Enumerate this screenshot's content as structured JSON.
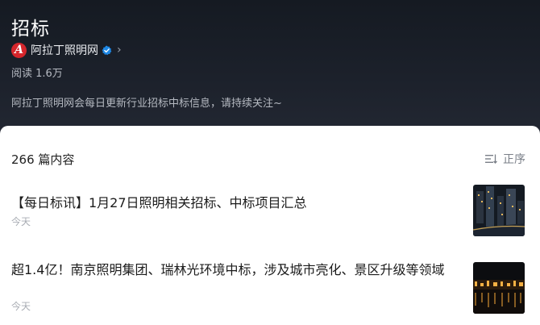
{
  "header": {
    "title": "招标",
    "author": {
      "name": "阿拉丁照明网",
      "logo_letter": "A"
    },
    "reads": "阅读 1.6万",
    "description": "阿拉丁照明网会每日更新行业招标中标信息，请持续关注~"
  },
  "list": {
    "count": "266 篇内容",
    "sort_label": "正序",
    "items": [
      {
        "title": "【每日标讯】1月27日照明相关招标、中标项目汇总",
        "time": "今天",
        "thumbnail": "city-night-aerial"
      },
      {
        "title": "超1.4亿！南京照明集团、瑞林光环境中标，涉及城市亮化、景区升级等领域",
        "time": "今天",
        "thumbnail": "waterfront-night-lights"
      }
    ]
  },
  "colors": {
    "accent": "#d5262c",
    "verified": "#1e88e5"
  }
}
